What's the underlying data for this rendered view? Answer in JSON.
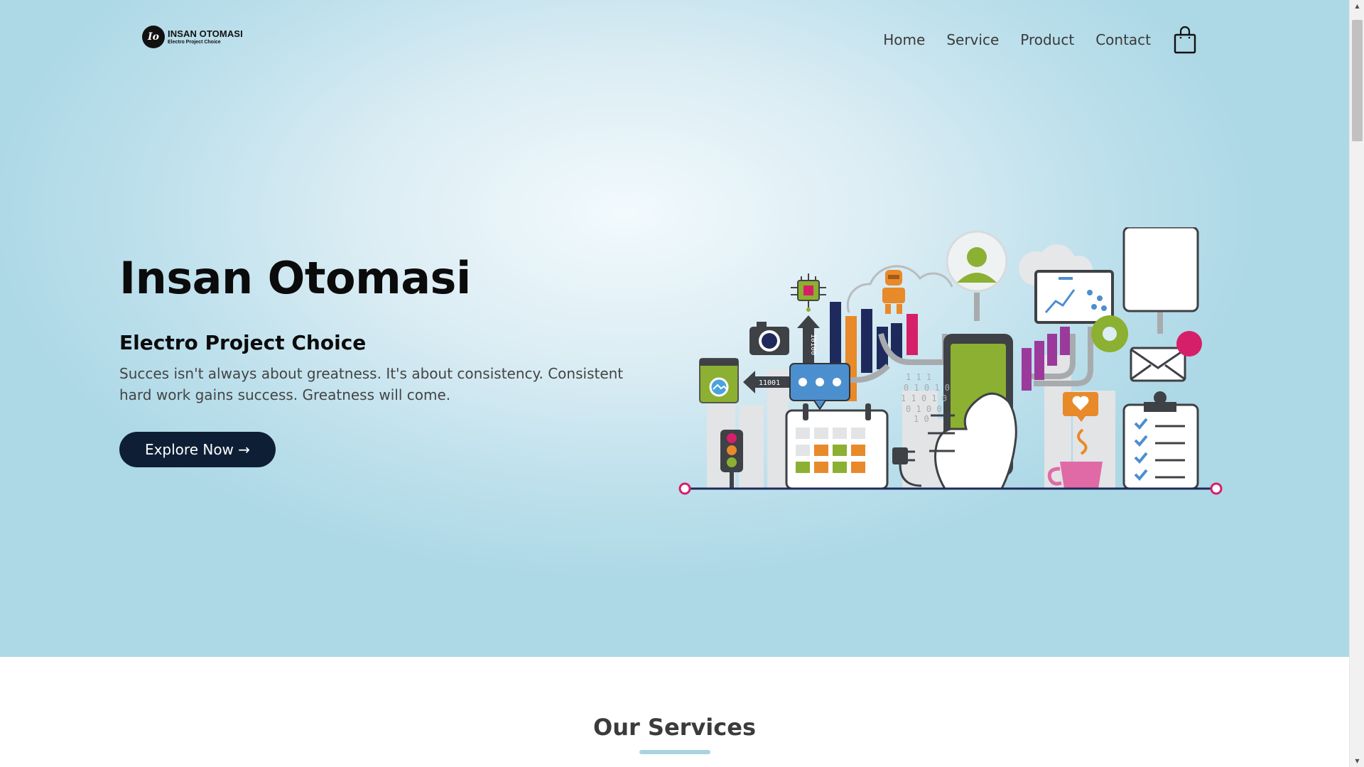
{
  "brand": {
    "logo_mark": "Io",
    "name": "INSAN OTOMASI",
    "tagline": "Electro Project Choice"
  },
  "nav": {
    "items": [
      {
        "label": "Home"
      },
      {
        "label": "Service"
      },
      {
        "label": "Product"
      },
      {
        "label": "Contact"
      }
    ],
    "cart_icon": "shopping-bag-icon"
  },
  "hero": {
    "title": "Insan Otomasi",
    "subtitle": "Electro Project Choice",
    "description": "Succes isn't always about greatness. It's about consistency. Consistent hard work gains success. Greatness will come.",
    "cta_label": "Explore Now →",
    "illustration_text": {
      "binary_vertical": "10100",
      "binary_horizontal": "11001",
      "binary_scatter": [
        "1 1 1",
        "0 1 0 1 0",
        "1 1 0 1 0",
        "0 1 0 0",
        "1 0"
      ]
    }
  },
  "services": {
    "title": "Our Services"
  },
  "colors": {
    "hero_bg": "#add8e6",
    "button_bg": "#0e1f35",
    "accent_green": "#8cb031",
    "accent_pink": "#d61f69",
    "accent_orange": "#e8892a",
    "accent_navy": "#1f2a5c",
    "accent_purple": "#9b3a9a",
    "underline": "#a9d3e2"
  },
  "scrollbar": {
    "up_icon": "scroll-up-arrow-icon",
    "down_icon": "scroll-down-arrow-icon"
  }
}
